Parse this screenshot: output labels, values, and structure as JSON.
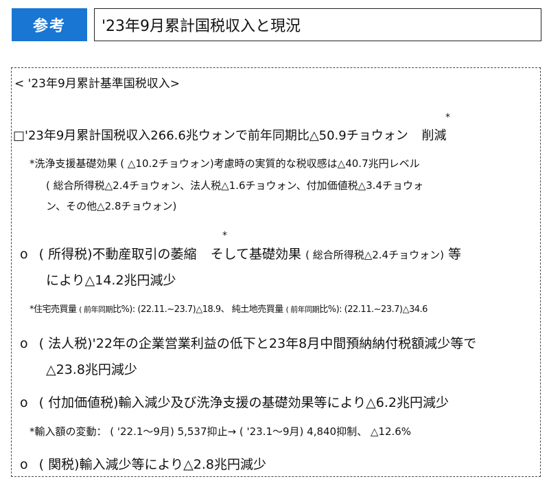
{
  "header": {
    "badge": "参考",
    "title": "'23年9月累計国税収入と現況"
  },
  "section": {
    "heading": "< '23年9月累計基準国税収入>",
    "star": "*",
    "summary": "□'23年9月累計国税収入266.6兆ウォンで前年同期比△50.9チョウォン",
    "summary_tail": "削減",
    "note1": "*洗浄支援基礎効果 ( △10.2チョウォン)考慮時の実質的な税収感は△40.7兆円レベル",
    "note2": "( 総合所得税△2.4チョウォン、法人税△1.6チョウォン、付加価値税△3.4チョウォ",
    "note3": "ン、その他△2.8チョウォン)"
  },
  "items": [
    {
      "bullet": "o",
      "line1_a": "( 所得税)不動産取引の萎縮",
      "line1_b": "そして基礎効果",
      "line1_c": "( 総合所得税△2.4チョウォン)",
      "line1_d": "等",
      "line2": "により△14.2兆円減少",
      "note_a": "*住宅売買量",
      "note_b": "( 前年同期",
      "note_c": "比%): (22.11.~23.7)△18.9、 純土地売買量",
      "note_d": "( 前年同期",
      "note_e": "比%): (22.11.~23.7)△34.6"
    },
    {
      "bullet": "o",
      "line1": "( 法人税)'22年の企業営業利益の低下と23年8月中間預納納付税額減少等で",
      "line2": "△23.8兆円減少"
    },
    {
      "bullet": "o",
      "line1": "( 付加価値税)輸入減少及び洗浄支援の基礎効果等により△6.2兆円減少",
      "note": "*輸入額の変動： ( '22.1～9月) 5,537抑止→ ( '23.1～9月) 4,840抑制、 △12.6%"
    },
    {
      "bullet": "o",
      "line1": "( 関税)輸入減少等により△2.8兆円減少"
    }
  ]
}
